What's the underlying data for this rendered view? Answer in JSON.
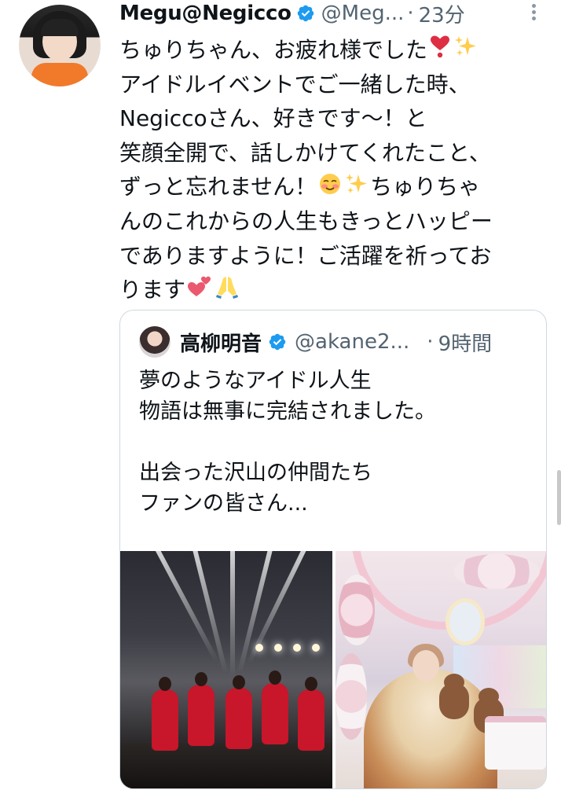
{
  "tweet": {
    "author_name": "Megu@Negicco",
    "handle": "@Meg...",
    "separator": "·",
    "time": "23分",
    "text_lines": [
      "ちゅりちゃん、お疲れ様でした",
      "アイドルイベントでご一緒した時、",
      "Negiccoさん、好きです〜！と",
      "笑顔全開で、話しかけてくれたこと、",
      "ずっと忘れません！",
      "んのこれからの人生もきっとハッピー",
      "でありますように！ご活躍を祈ってお",
      "ります"
    ],
    "text_line5_tail": "ちゅりちゃ",
    "emoji": {
      "heart_exclamation": "❣️",
      "sparkles": "✨",
      "smiling_blush": "☺️",
      "two_hearts": "💕",
      "folded_hands": "🙏"
    }
  },
  "quote": {
    "author_name": "高柳明音",
    "handle": "@akane2...",
    "separator": "·",
    "time": "9時間",
    "text_lines": [
      "夢のようなアイドル人生",
      "物語は無事に完結されました。",
      "",
      "出会った沢山の仲間たち",
      "ファンの皆さん..."
    ]
  },
  "colors": {
    "verified": "#1d9bf0",
    "text": "#0f1419",
    "secondary_text": "#536471",
    "border": "#cfd9de"
  },
  "icons": [
    "verified-badge-icon",
    "more-options-icon"
  ]
}
